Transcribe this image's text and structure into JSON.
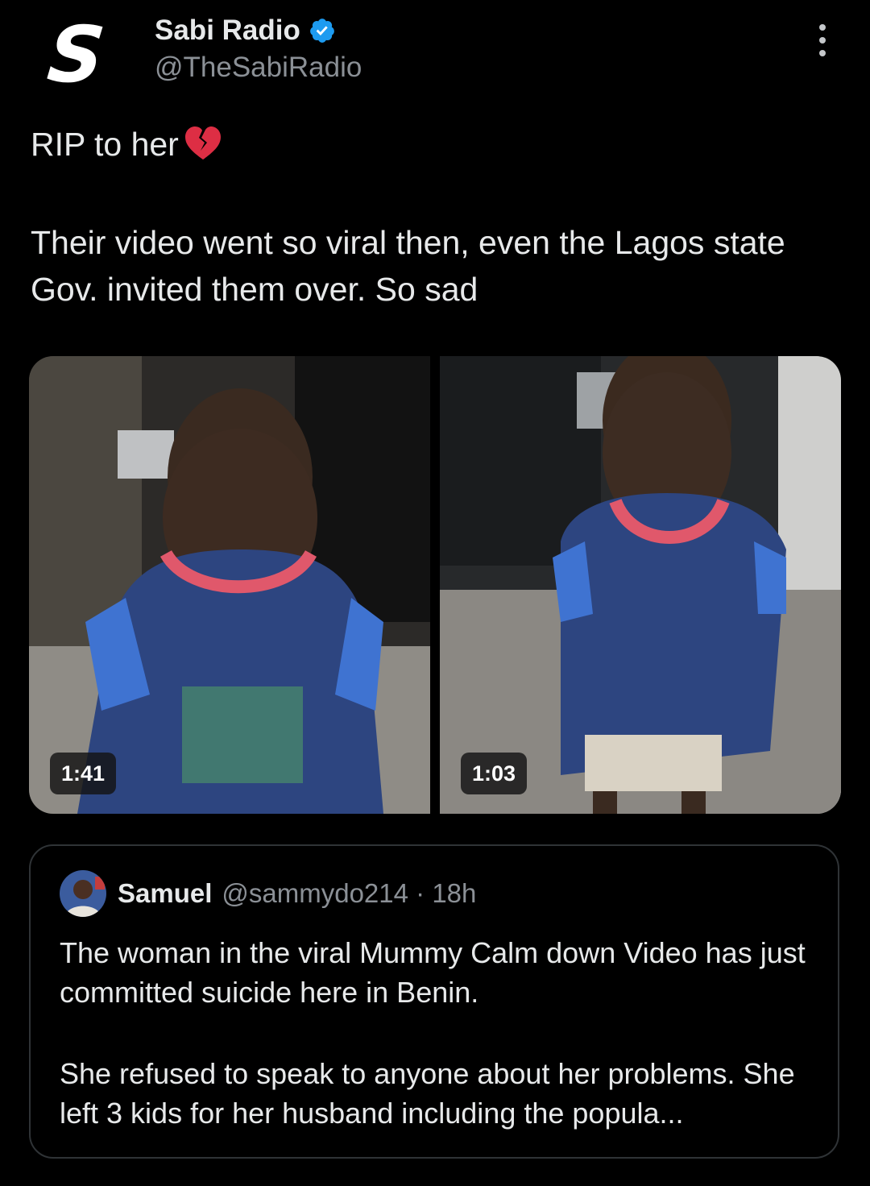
{
  "author": {
    "display_name": "Sabi Radio",
    "handle": "@TheSabiRadio",
    "logo_letter": "S",
    "verified_icon": "verified-badge-icon"
  },
  "more_icon": "more-options-icon",
  "post": {
    "line1": "RIP to her",
    "line1_emoji": "broken-heart-icon",
    "line2": "Their video went so viral then, even the Lagos state Gov. invited them over. So sad"
  },
  "media": [
    {
      "duration": "1:41"
    },
    {
      "duration": "1:03"
    }
  ],
  "quoted_post": {
    "display_name": "Samuel",
    "meta": "@sammydo214 · 18h",
    "paragraph1": "The woman in the viral Mummy Calm down Video has just committed suicide here in Benin.",
    "paragraph2": "She refused to speak to anyone about her problems. She left 3 kids for her husband including the popula..."
  },
  "colors": {
    "background": "#000000",
    "text": "#e7e9ea",
    "secondary_text": "#8b9096",
    "verified_blue": "#1d9bf0",
    "border": "#2f3336"
  }
}
